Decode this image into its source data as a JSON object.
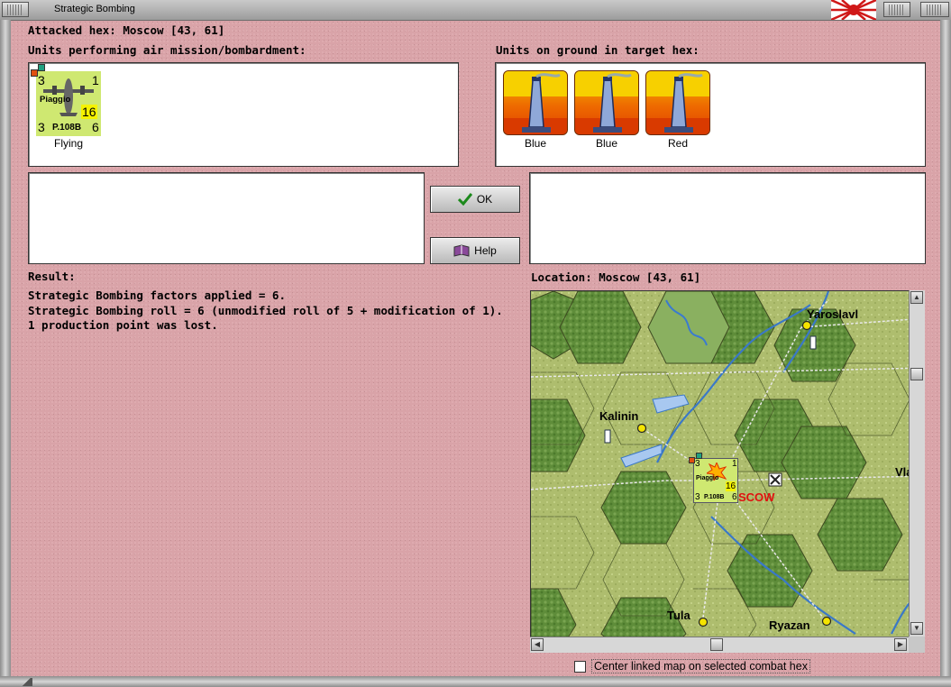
{
  "window": {
    "title": "Strategic Bombing"
  },
  "header": {
    "attacked_hex": "Attacked hex: Moscow  [43, 61]",
    "air_units_label": "Units performing air mission/bombardment:",
    "ground_units_label": "Units on ground in target hex:"
  },
  "air_units": [
    {
      "name": "Piaggio",
      "type": "P.108B",
      "top_left": "3",
      "top_right": "1",
      "bottom_left": "3",
      "bottom_right": "6",
      "range": "16",
      "status": "Flying"
    }
  ],
  "ground_units": [
    {
      "label": "Blue",
      "icon": "factory-icon"
    },
    {
      "label": "Blue",
      "icon": "factory-icon"
    },
    {
      "label": "Red",
      "icon": "factory-icon"
    }
  ],
  "buttons": {
    "ok": "OK",
    "help": "Help"
  },
  "result": {
    "label": "Result:",
    "lines": [
      "Strategic Bombing factors applied = 6.",
      "Strategic Bombing roll = 6 (unmodified roll of 5 + modification of 1).",
      "1 production point was lost."
    ]
  },
  "location": {
    "label": "Location:  Moscow  [43, 61]"
  },
  "map": {
    "cities": [
      "Yaroslavl",
      "Kalinin",
      "SCOW",
      "Vla",
      "Tula",
      "Ryazan"
    ],
    "counter": {
      "name": "Piaggio",
      "type": "P.108B",
      "top_left": "3",
      "top_right": "1",
      "bottom_left": "3",
      "bottom_right": "6",
      "range": "16"
    }
  },
  "checkbox": {
    "label": "Center linked map on selected combat hex",
    "checked": false
  },
  "colors": {
    "background": "#d9a3a8",
    "counter": "#cfe871",
    "moscow_text": "#e01010"
  }
}
